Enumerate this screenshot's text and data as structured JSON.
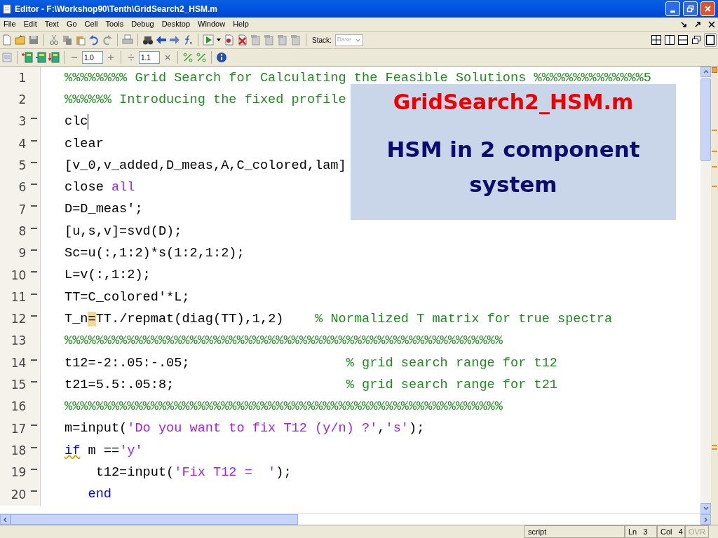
{
  "window": {
    "title": "Editor - F:\\Workshop90\\Tenth\\GridSearch2_HSM.m"
  },
  "menu": [
    "File",
    "Edit",
    "Text",
    "Go",
    "Cell",
    "Tools",
    "Debug",
    "Desktop",
    "Window",
    "Help"
  ],
  "toolbar": {
    "stack_label": "Stack:",
    "stack_value": "Base",
    "stack_disabled": true
  },
  "cell_toolbar": {
    "decrement_value": "1.0",
    "divide_value": "1.1"
  },
  "lines": [
    {
      "number": "1",
      "executable": false,
      "cursor": false,
      "segments": [
        {
          "kind": "comment",
          "text": "%%%%%%%% Grid Search for Calculating the Feasible Solutions %%%%%%%%%%%%%%5"
        }
      ]
    },
    {
      "number": "2",
      "executable": false,
      "cursor": false,
      "segments": [
        {
          "kind": "comment",
          "text": "%%%%%% Introducing the fixed profile"
        }
      ]
    },
    {
      "number": "3",
      "executable": true,
      "cursor": true,
      "segments": [
        {
          "kind": "code",
          "text": "clc"
        }
      ]
    },
    {
      "number": "4",
      "executable": true,
      "cursor": false,
      "segments": [
        {
          "kind": "code",
          "text": "clear"
        }
      ]
    },
    {
      "number": "5",
      "executable": true,
      "cursor": false,
      "segments": [
        {
          "kind": "code",
          "text": "[v_0,v_added,D_meas,A,C_colored,lam]"
        }
      ]
    },
    {
      "number": "6",
      "executable": true,
      "cursor": false,
      "segments": [
        {
          "kind": "code",
          "text": "close "
        },
        {
          "kind": "string",
          "text": "all"
        }
      ]
    },
    {
      "number": "7",
      "executable": true,
      "cursor": false,
      "segments": [
        {
          "kind": "code",
          "text": "D=D_meas';"
        }
      ]
    },
    {
      "number": "8",
      "executable": true,
      "cursor": false,
      "segments": [
        {
          "kind": "code",
          "text": "[u,s,v]=svd(D);"
        }
      ]
    },
    {
      "number": "9",
      "executable": true,
      "cursor": false,
      "segments": [
        {
          "kind": "code",
          "text": "Sc=u(:,1:2)*s(1:2,1:2);"
        }
      ]
    },
    {
      "number": "10",
      "executable": true,
      "cursor": false,
      "segments": [
        {
          "kind": "code",
          "text": "L=v(:,1:2);"
        }
      ]
    },
    {
      "number": "11",
      "executable": true,
      "cursor": false,
      "segments": [
        {
          "kind": "code",
          "text": "TT=C_colored'*L;"
        }
      ]
    },
    {
      "number": "12",
      "executable": true,
      "cursor": false,
      "segments": [
        {
          "kind": "code",
          "text": "T_n"
        },
        {
          "kind": "flagged",
          "text": "="
        },
        {
          "kind": "code",
          "text": "TT./repmat(diag(TT),1,2)    "
        },
        {
          "kind": "comment",
          "text": "% Normalized T matrix for true spectra"
        }
      ]
    },
    {
      "number": "13",
      "executable": false,
      "cursor": false,
      "segments": [
        {
          "kind": "comment",
          "text": "%%%%%%%%%%%%%%%%%%%%%%%%%%%%%%%%%%%%%%%%%%%%%%%%%%%%%%%%"
        }
      ]
    },
    {
      "number": "14",
      "executable": true,
      "cursor": false,
      "segments": [
        {
          "kind": "code",
          "text": "t12=-2:.05:-.05;                    "
        },
        {
          "kind": "comment",
          "text": "% grid search range for t12"
        }
      ]
    },
    {
      "number": "15",
      "executable": true,
      "cursor": false,
      "segments": [
        {
          "kind": "code",
          "text": "t21=5.5:.05:8;                      "
        },
        {
          "kind": "comment",
          "text": "% grid search range for t21"
        }
      ]
    },
    {
      "number": "16",
      "executable": false,
      "cursor": false,
      "segments": [
        {
          "kind": "comment",
          "text": "%%%%%%%%%%%%%%%%%%%%%%%%%%%%%%%%%%%%%%%%%%%%%%%%%%%%%%%%"
        }
      ]
    },
    {
      "number": "17",
      "executable": true,
      "cursor": false,
      "segments": [
        {
          "kind": "code",
          "text": "m=input("
        },
        {
          "kind": "string",
          "text": "'Do you want to fix T12 (y/n) ?'"
        },
        {
          "kind": "code",
          "text": ","
        },
        {
          "kind": "string",
          "text": "'s'"
        },
        {
          "kind": "code",
          "text": ");"
        }
      ]
    },
    {
      "number": "18",
      "executable": true,
      "cursor": false,
      "segments": [
        {
          "kind": "keyword_warning",
          "text": "if"
        },
        {
          "kind": "code",
          "text": " m =="
        },
        {
          "kind": "string",
          "text": "'y'"
        }
      ]
    },
    {
      "number": "19",
      "executable": true,
      "cursor": false,
      "segments": [
        {
          "kind": "code",
          "text": "    t12=input("
        },
        {
          "kind": "string",
          "text": "'Fix T12 =  '"
        },
        {
          "kind": "code",
          "text": ");"
        }
      ]
    },
    {
      "number": "20",
      "executable": true,
      "cursor": false,
      "segments": [
        {
          "kind": "keyword",
          "text": "   end"
        }
      ]
    }
  ],
  "overlay": {
    "title": "GridSearch2_HSM.m",
    "subtitle": "HSM in 2 component system"
  },
  "status_bar": {
    "file_type": "script",
    "line": "Ln   3",
    "column": "Col   4",
    "overwrite": {
      "label": "OVR",
      "enabled": false
    }
  }
}
